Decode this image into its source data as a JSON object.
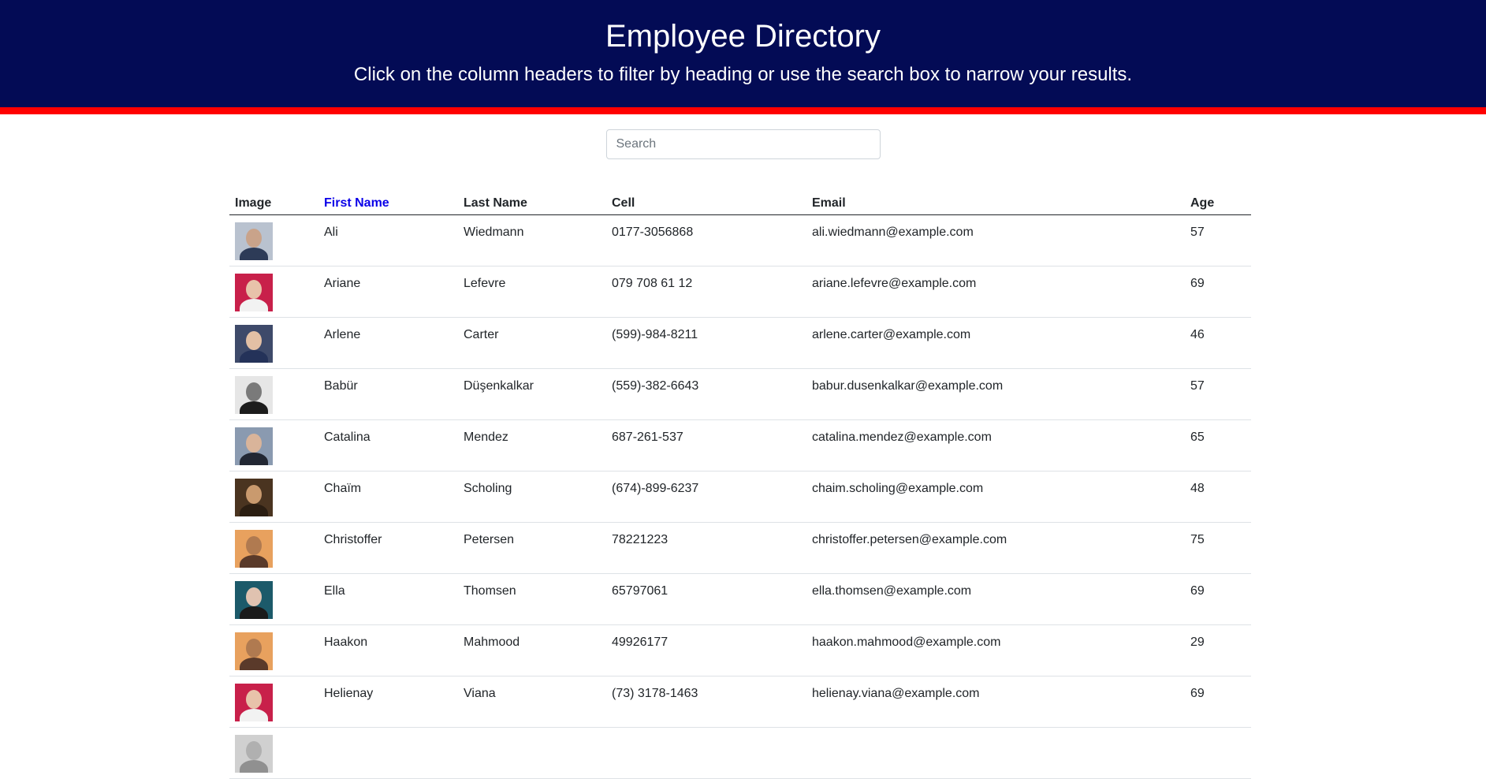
{
  "header": {
    "title": "Employee Directory",
    "subtitle": "Click on the column headers to filter by heading or use the search box to narrow your results."
  },
  "search": {
    "placeholder": "Search",
    "value": ""
  },
  "table": {
    "columns": [
      "Image",
      "First Name",
      "Last Name",
      "Cell",
      "Email",
      "Age"
    ],
    "sorted_column": "First Name",
    "sorted_color": "#0a00e8",
    "rows": [
      {
        "first": "Ali",
        "last": "Wiedmann",
        "cell": "0177-3056868",
        "email": "ali.wiedmann@example.com",
        "age": "57",
        "avatar": {
          "bg": "#b9c2cf",
          "skin": "#c9a38a",
          "shirt": "#2d3b57"
        }
      },
      {
        "first": "Ariane",
        "last": "Lefevre",
        "cell": "079 708 61 12",
        "email": "ariane.lefevre@example.com",
        "age": "69",
        "avatar": {
          "bg": "#c8204a",
          "skin": "#e8c2aa",
          "shirt": "#f2f2f2"
        }
      },
      {
        "first": "Arlene",
        "last": "Carter",
        "cell": "(599)-984-8211",
        "email": "arlene.carter@example.com",
        "age": "46",
        "avatar": {
          "bg": "#3e4a6a",
          "skin": "#e3c0a5",
          "shirt": "#243259"
        }
      },
      {
        "first": "Babür",
        "last": "Düşenkalkar",
        "cell": "(559)-382-6643",
        "email": "babur.dusenkalkar@example.com",
        "age": "57",
        "avatar": {
          "bg": "#e6e6e6",
          "skin": "#7a7a7a",
          "shirt": "#1c1c1c"
        }
      },
      {
        "first": "Catalina",
        "last": "Mendez",
        "cell": "687-261-537",
        "email": "catalina.mendez@example.com",
        "age": "65",
        "avatar": {
          "bg": "#8a9ab0",
          "skin": "#d9b49a",
          "shirt": "#222733"
        }
      },
      {
        "first": "Chaïm",
        "last": "Scholing",
        "cell": "(674)-899-6237",
        "email": "chaim.scholing@example.com",
        "age": "48",
        "avatar": {
          "bg": "#4a3420",
          "skin": "#c99a6e",
          "shirt": "#2b1e12"
        }
      },
      {
        "first": "Christoffer",
        "last": "Petersen",
        "cell": "78221223",
        "email": "christoffer.petersen@example.com",
        "age": "75",
        "avatar": {
          "bg": "#e8a15e",
          "skin": "#b07a50",
          "shirt": "#5a3a2a"
        }
      },
      {
        "first": "Ella",
        "last": "Thomsen",
        "cell": "65797061",
        "email": "ella.thomsen@example.com",
        "age": "69",
        "avatar": {
          "bg": "#1c5a6a",
          "skin": "#e0c2b0",
          "shirt": "#1a1a1a"
        }
      },
      {
        "first": "Haakon",
        "last": "Mahmood",
        "cell": "49926177",
        "email": "haakon.mahmood@example.com",
        "age": "29",
        "avatar": {
          "bg": "#e8a15e",
          "skin": "#b07a50",
          "shirt": "#5a3a2a"
        }
      },
      {
        "first": "Helienay",
        "last": "Viana",
        "cell": "(73) 3178-1463",
        "email": "helienay.viana@example.com",
        "age": "69",
        "avatar": {
          "bg": "#c8204a",
          "skin": "#e8c2aa",
          "shirt": "#f2f2f2"
        }
      },
      {
        "first": "",
        "last": "",
        "cell": "",
        "email": "",
        "age": "",
        "avatar": {
          "bg": "#d0d0d0",
          "skin": "#b0b0b0",
          "shirt": "#909090"
        }
      }
    ]
  },
  "colors": {
    "header_bg": "#030b55",
    "header_border": "#ff0000",
    "header_text": "#ffffff"
  }
}
